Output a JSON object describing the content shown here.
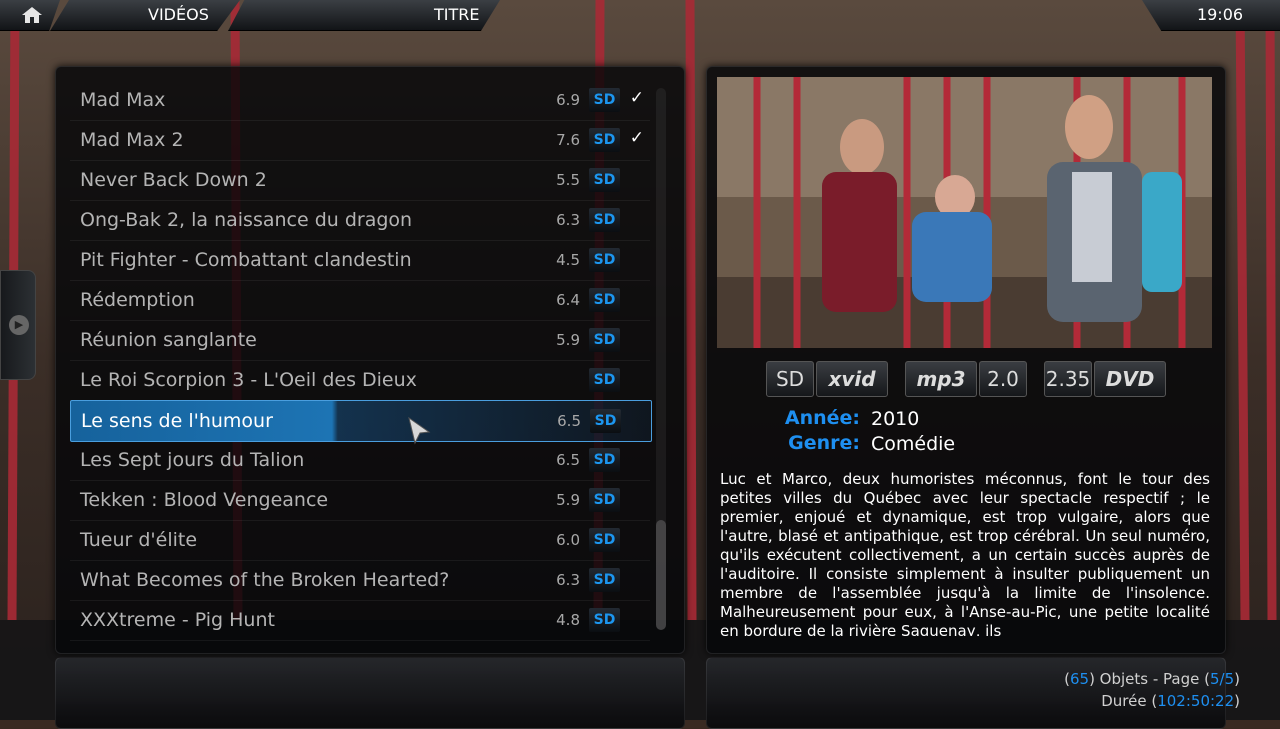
{
  "header": {
    "section": "VIDÉOS",
    "sort": "TITRE",
    "clock": "19:06"
  },
  "list": {
    "items": [
      {
        "title": "Mad Max",
        "rating": "6.9",
        "badge": "SD",
        "watched": "✓"
      },
      {
        "title": "Mad Max 2",
        "rating": "7.6",
        "badge": "SD",
        "watched": "✓"
      },
      {
        "title": "Never Back Down 2",
        "rating": "5.5",
        "badge": "SD",
        "watched": ""
      },
      {
        "title": "Ong-Bak 2, la naissance du dragon",
        "rating": "6.3",
        "badge": "SD",
        "watched": ""
      },
      {
        "title": "Pit Fighter - Combattant clandestin",
        "rating": "4.5",
        "badge": "SD",
        "watched": ""
      },
      {
        "title": "Rédemption",
        "rating": "6.4",
        "badge": "SD",
        "watched": ""
      },
      {
        "title": "Réunion sanglante",
        "rating": "5.9",
        "badge": "SD",
        "watched": ""
      },
      {
        "title": "Le Roi Scorpion 3 - L'Oeil des Dieux",
        "rating": "",
        "badge": "SD",
        "watched": ""
      },
      {
        "title": "Le sens de l'humour",
        "rating": "6.5",
        "badge": "SD",
        "watched": ""
      },
      {
        "title": "Les Sept jours du Talion",
        "rating": "6.5",
        "badge": "SD",
        "watched": ""
      },
      {
        "title": "Tekken : Blood Vengeance",
        "rating": "5.9",
        "badge": "SD",
        "watched": ""
      },
      {
        "title": "Tueur d'élite",
        "rating": "6.0",
        "badge": "SD",
        "watched": ""
      },
      {
        "title": "What Becomes of the Broken Hearted?",
        "rating": "6.3",
        "badge": "SD",
        "watched": ""
      },
      {
        "title": "XXXtreme - Pig Hunt",
        "rating": "4.8",
        "badge": "SD",
        "watched": ""
      }
    ],
    "selected_index": 8
  },
  "info": {
    "flags": {
      "resolution": "SD",
      "video_codec": "xvid",
      "audio_codec": "mp3",
      "channels": "2.0",
      "aspect": "2.35",
      "source": "DVD"
    },
    "year_label": "Année:",
    "year": "2010",
    "genre_label": "Genre:",
    "genre": "Comédie",
    "plot": "Luc et Marco, deux humoristes méconnus, font le tour des petites villes du Québec avec leur spectacle respectif ; le premier, enjoué et dynamique, est trop vulgaire, alors que l'autre, blasé et antipathique, est trop cérébral. Un seul numéro, qu'ils exécutent collectivement, a un certain succès auprès de l'auditoire. Il consiste simplement à insulter publiquement un membre de l'assemblée jusqu'à la limite de l'insolence. Malheureusement pour eux, à l'Anse-au-Pic, une petite localité en bordure de la rivière Saguenay, ils"
  },
  "footer": {
    "count_open": "(",
    "count": "65",
    "count_close": ") Objets - Page (",
    "page": "5/5",
    "page_close": ")",
    "duration_label": "Durée (",
    "duration": "102:50:22",
    "duration_close": ")"
  },
  "colors": {
    "accent": "#1e8ff0",
    "selection": "#1d74b4"
  }
}
